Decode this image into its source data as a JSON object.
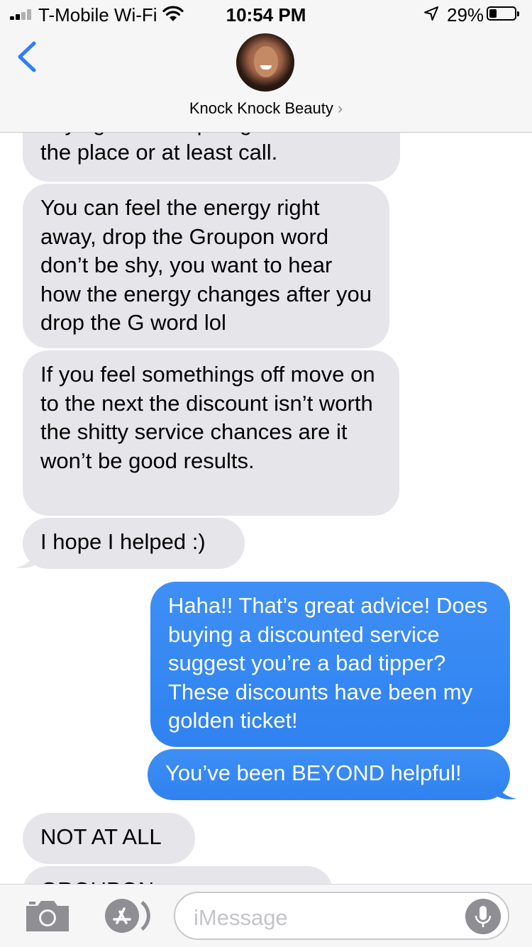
{
  "status_bar": {
    "carrier": "T-Mobile Wi-Fi",
    "time": "10:54 PM",
    "battery_percent": "29%",
    "battery_level": 0.29
  },
  "header": {
    "contact_name": "Knock Knock Beauty",
    "chevron": "›",
    "back_icon": "chevron-left-icon"
  },
  "messages": [
    {
      "side": "incoming",
      "text": "buying the Groupon go check out the place or at least call."
    },
    {
      "side": "incoming",
      "text": "You can feel the energy right away, drop the Groupon word don’t be shy, you want to hear how the energy changes after you drop the G word lol"
    },
    {
      "side": "incoming",
      "text": "If you feel somethings off move on to the next the discount isn’t worth the shitty service chances are it won’t be good results."
    },
    {
      "side": "incoming",
      "text": "I hope I helped :)"
    },
    {
      "side": "outgoing",
      "text": "Haha!! That’s great advice! Does buying a discounted service suggest you’re a bad tipper? These discounts have been my golden ticket!"
    },
    {
      "side": "outgoing",
      "text": "You’ve been BEYOND helpful!"
    },
    {
      "side": "incoming",
      "text": "NOT AT ALL"
    },
    {
      "side": "incoming",
      "text": "GROUPON ..."
    }
  ],
  "input_bar": {
    "placeholder": "iMessage",
    "camera_icon": "camera-icon",
    "apps_icon": "app-store-icon",
    "mic_icon": "microphone-icon"
  },
  "colors": {
    "incoming_bubble": "#e5e5ea",
    "outgoing_bubble": "#2f85f6",
    "accent": "#2f7cf6"
  }
}
